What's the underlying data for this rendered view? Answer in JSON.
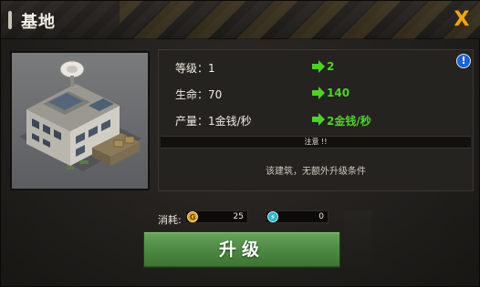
{
  "header": {
    "title": "基地",
    "close_label": "X"
  },
  "building": {
    "preview_icon": "base-building-image"
  },
  "stats": [
    {
      "label": "等级：1",
      "next": "2"
    },
    {
      "label": "生命：70",
      "next": "140"
    },
    {
      "label": "产量：1金钱/秒",
      "next": "2金钱/秒"
    }
  ],
  "info_icon_glyph": "!",
  "notice": {
    "title": "注意 !!",
    "text": "该建筑，无额外升级条件"
  },
  "cost": {
    "label": "消耗:",
    "gold": {
      "icon_glyph": "G",
      "value": "25"
    },
    "energy": {
      "icon_glyph": "⚡",
      "value": "0"
    }
  },
  "upgrade_button_label": "升级",
  "colors": {
    "accent_gold": "#f0a516",
    "stat_green": "#4fd12c",
    "button_green": "#4f8c45"
  }
}
